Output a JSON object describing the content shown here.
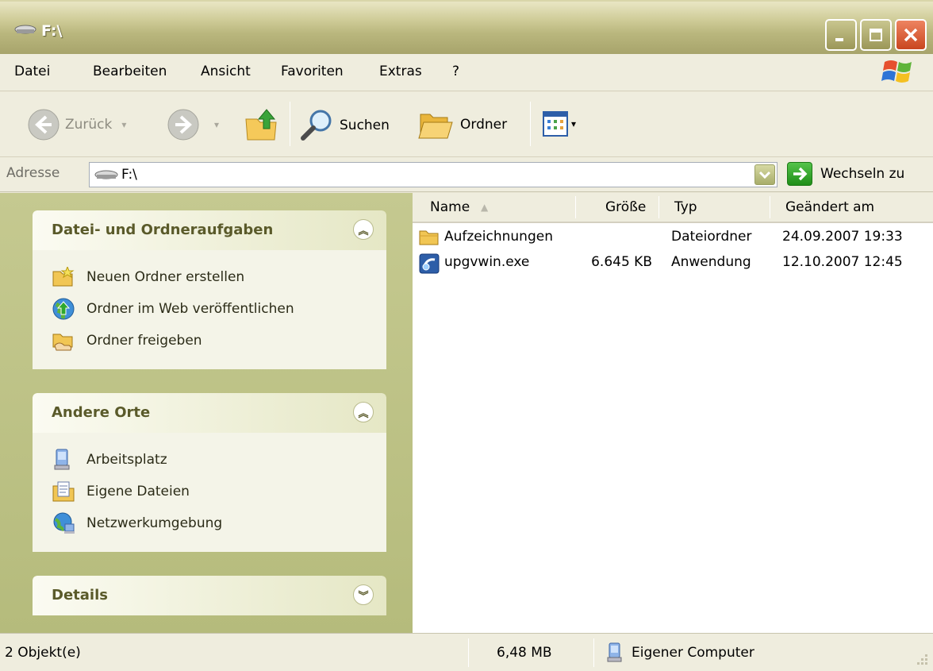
{
  "window": {
    "title": "F:\\"
  },
  "menu": {
    "items": [
      "Datei",
      "Bearbeiten",
      "Ansicht",
      "Favoriten",
      "Extras",
      "?"
    ]
  },
  "toolbar": {
    "back_label": "Zurück",
    "search_label": "Suchen",
    "folders_label": "Ordner"
  },
  "address": {
    "label": "Adresse",
    "value": "F:\\",
    "go_label": "Wechseln zu"
  },
  "taskpane": {
    "file_tasks": {
      "title": "Datei- und Ordneraufgaben",
      "items": [
        "Neuen Ordner erstellen",
        "Ordner im Web veröffentlichen",
        "Ordner freigeben"
      ]
    },
    "other_places": {
      "title": "Andere Orte",
      "items": [
        "Arbeitsplatz",
        "Eigene Dateien",
        "Netzwerkumgebung"
      ]
    },
    "details": {
      "title": "Details"
    }
  },
  "filelist": {
    "columns": {
      "name": "Name",
      "size": "Größe",
      "type": "Typ",
      "modified": "Geändert am"
    },
    "rows": [
      {
        "name": "Aufzeichnungen",
        "size": "",
        "type": "Dateiordner",
        "modified": "24.09.2007 19:33",
        "icon": "folder-icon"
      },
      {
        "name": "upgvwin.exe",
        "size": "6.645 KB",
        "type": "Anwendung",
        "modified": "12.10.2007 12:45",
        "icon": "application-icon"
      }
    ]
  },
  "status": {
    "objects": "2 Objekt(e)",
    "size": "6,48 MB",
    "zone": "Eigener Computer"
  },
  "colors": {
    "titlebar": "#b5b27a",
    "taskpane": "#c0c48a",
    "chrome": "#EFEDDE",
    "close_button": "#d85a33"
  }
}
